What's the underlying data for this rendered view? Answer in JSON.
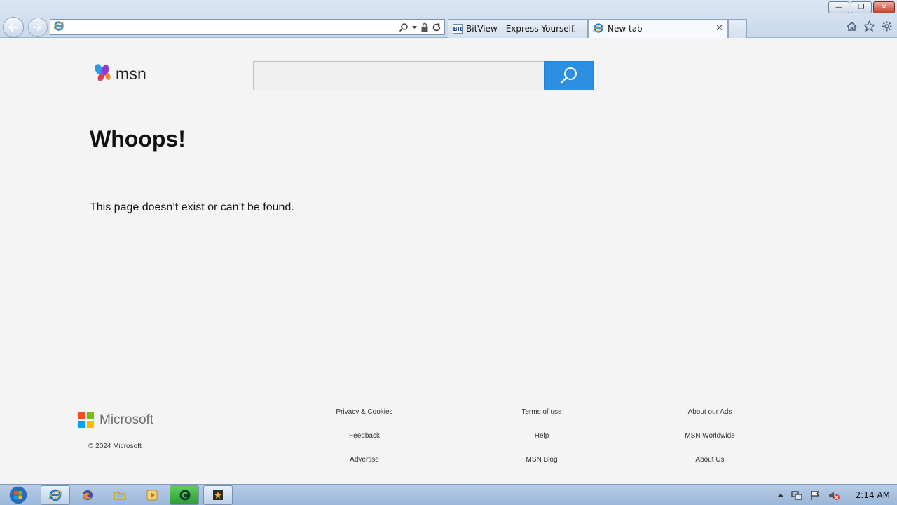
{
  "browser": {
    "address_value": "",
    "tabs": [
      {
        "favicon": "BIt",
        "title": "BitView - Express Yourself."
      },
      {
        "favicon": "ie-icon",
        "title": "New tab"
      }
    ],
    "icons": [
      "back-arrow-icon",
      "forward-arrow-icon",
      "search-icon",
      "dropdown-icon",
      "lock-icon",
      "refresh-icon",
      "home-icon",
      "favorites-star-icon",
      "settings-gear-icon"
    ]
  },
  "page": {
    "logo_text": "msn",
    "search_placeholder": "",
    "heading": "Whoops!",
    "message": "This page doesn’t exist or can’t be found.",
    "accent_color": "#2d8fe1"
  },
  "footer": {
    "company": "Microsoft",
    "copyright": "© 2024 Microsoft",
    "links": {
      "privacy": "Privacy & Cookies",
      "terms": "Terms of use",
      "about_ads": "About our Ads",
      "feedback": "Feedback",
      "help": "Help",
      "worldwide": "MSN Worldwide",
      "advertise": "Advertise",
      "blog": "MSN Blog",
      "about_us": "About Us"
    }
  },
  "taskbar": {
    "clock": "2:14 AM",
    "apps": [
      "internet-explorer",
      "firefox",
      "file-explorer",
      "media-player",
      "gamemaker",
      "movie-maker"
    ]
  }
}
